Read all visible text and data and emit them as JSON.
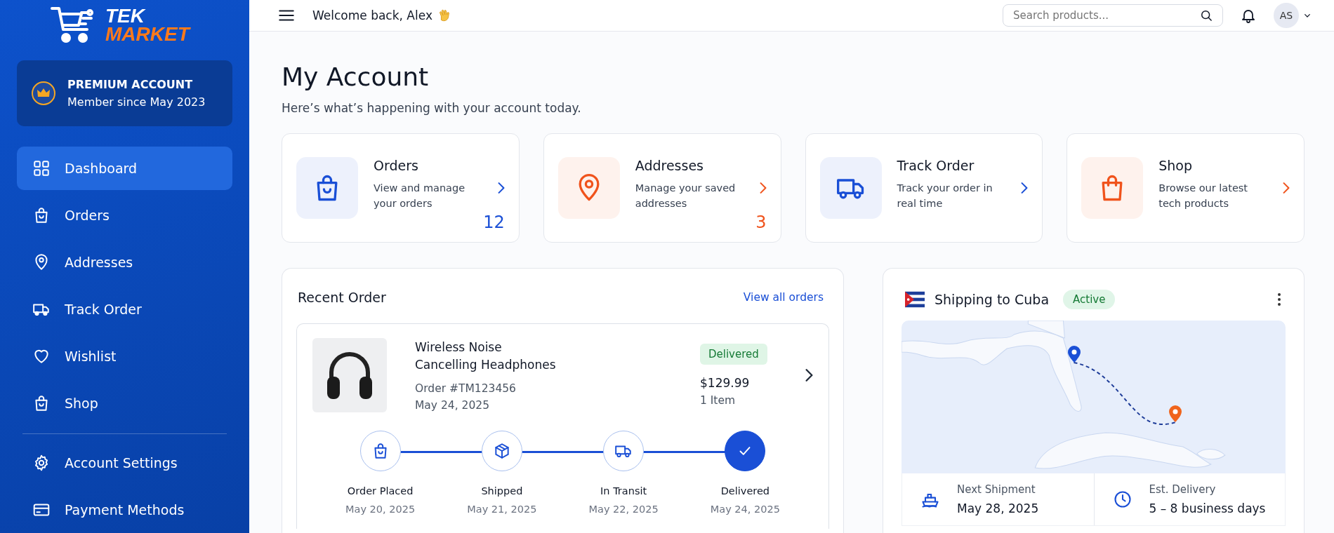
{
  "header": {
    "welcome": "Welcome back, Alex",
    "search": {
      "placeholder": "Search products..."
    },
    "avatar": "AS"
  },
  "sidebar": {
    "logo": {
      "line_1": "TEK",
      "line_2": "MARKET"
    },
    "premium": {
      "title": "PREMIUM ACCOUNT",
      "subtitle": "Member since May 2023"
    },
    "items": [
      {
        "label": "Dashboard",
        "selected": true
      },
      {
        "label": "Orders",
        "selected": false
      },
      {
        "label": "Addresses",
        "selected": false
      },
      {
        "label": "Track Order",
        "selected": false
      },
      {
        "label": "Wishlist",
        "selected": false
      },
      {
        "label": "Shop",
        "selected": false
      }
    ],
    "settings_items": [
      {
        "label": "Account Settings",
        "selected": false
      },
      {
        "label": "Payment Methods",
        "selected": false
      }
    ]
  },
  "page": {
    "title": "My Account",
    "subtitle": "Here’s what’s happening with your account today."
  },
  "cards": [
    {
      "title": "Orders",
      "description": "View and manage your orders",
      "count": "12",
      "color": "#1a4fd6"
    },
    {
      "title": "Addresses",
      "description": "Manage your saved addresses",
      "count": "3",
      "color": "#f0531c"
    },
    {
      "title": "Track Order",
      "description": "Track your order in real time",
      "color": "#1a4fd6"
    },
    {
      "title": "Shop",
      "description": "Browse our latest tech products",
      "color": "#f0531c"
    }
  ],
  "recent_order": {
    "title": "Recent Order",
    "link": "View all orders",
    "item": {
      "name": "Wireless Noise Cancelling Headphones",
      "order_no": "Order #TM123456",
      "date": "May 24, 2025",
      "status": "Delivered",
      "price": "$129.99",
      "quantity": "1 Item"
    },
    "steps": [
      {
        "label": "Order Placed",
        "date": "May 20, 2025",
        "current": false
      },
      {
        "label": "Shipped",
        "date": "May 21, 2025",
        "current": false
      },
      {
        "label": "In Transit",
        "date": "May 22, 2025",
        "current": false
      },
      {
        "label": "Delivered",
        "date": "May 24, 2025",
        "current": true
      }
    ]
  },
  "shipping": {
    "title": "Shipping to Cuba",
    "status": "Active",
    "details": [
      {
        "label": "Next Shipment",
        "value": "May 28, 2025"
      },
      {
        "label": "Est. Delivery",
        "value": "5 – 8 business days"
      }
    ]
  }
}
